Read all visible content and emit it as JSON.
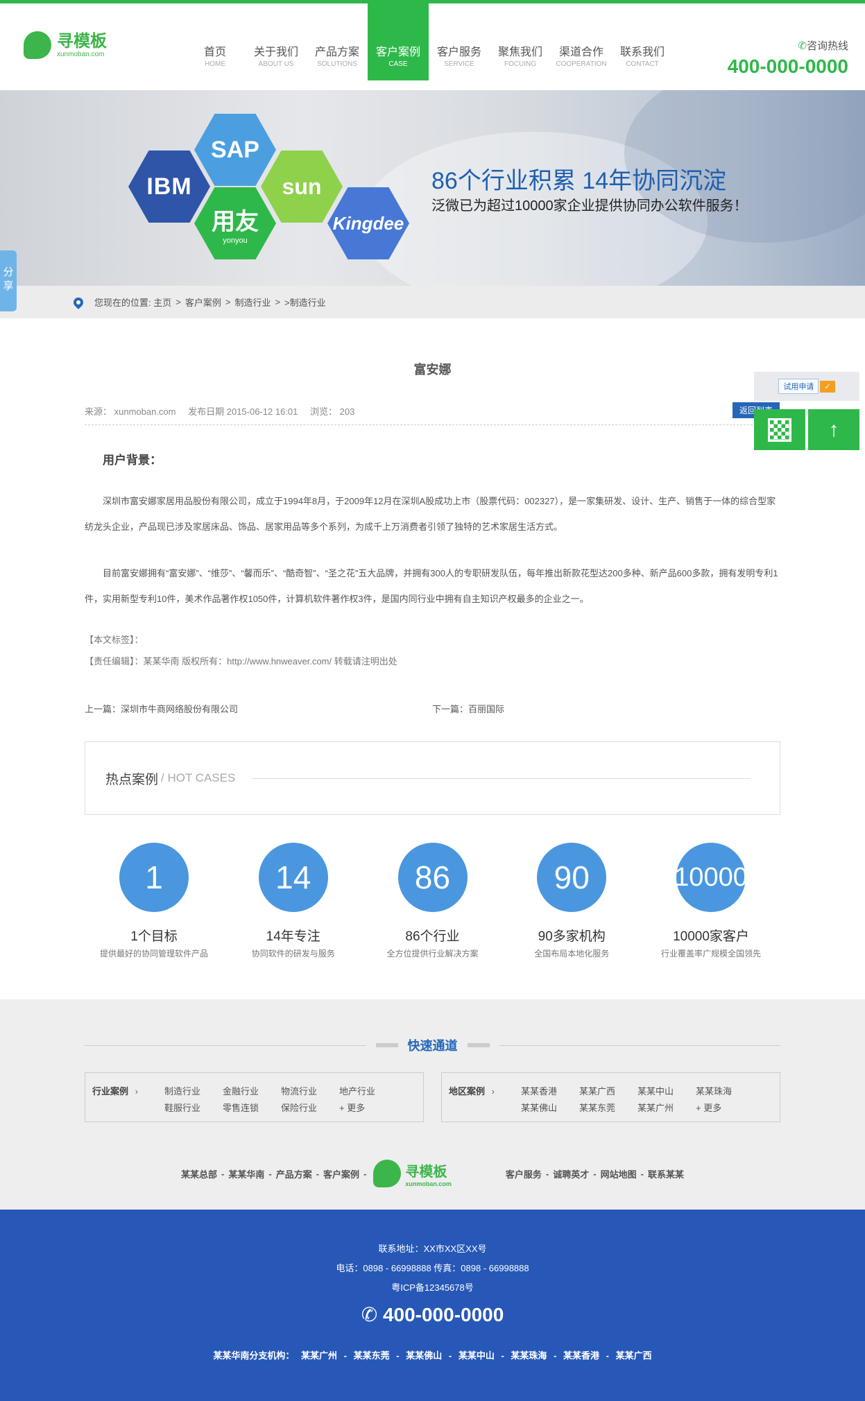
{
  "header": {
    "logo_cn": "寻模板",
    "logo_en": "xunmoban.com",
    "nav": [
      {
        "cn": "首页",
        "en": "HOME"
      },
      {
        "cn": "关于我们",
        "en": "ABOUT US"
      },
      {
        "cn": "产品方案",
        "en": "SOLUTIONS"
      },
      {
        "cn": "客户案例",
        "en": "CASE"
      },
      {
        "cn": "客户服务",
        "en": "SERVICE"
      },
      {
        "cn": "聚焦我们",
        "en": "FOCUING"
      },
      {
        "cn": "渠道合作",
        "en": "COOPERATION"
      },
      {
        "cn": "联系我们",
        "en": "CONTACT"
      }
    ],
    "hotline_label": "咨询热线",
    "hotline": "400-000-0000"
  },
  "banner": {
    "logos": {
      "ibm": "IBM",
      "sap": "SAP",
      "sun": "sun",
      "yonyou": "用友",
      "yonyou_en": "yonyou",
      "kingdee": "Kingdee"
    },
    "headline": "86个行业积累  14年协同沉淀",
    "subline": "泛微已为超过10000家企业提供协同办公软件服务！"
  },
  "share": "分享",
  "breadcrumb": [
    "您现在的位置: 主页",
    ">",
    "客户案例",
    ">",
    "制造行业",
    ">",
    ">制造行业"
  ],
  "article": {
    "title": "富安娜",
    "source": "来源： xunmoban.com",
    "date": "发布日期 2015-06-12 16:01",
    "views": "浏览： 203",
    "section": "用户背景：",
    "p1": "深圳市富安娜家居用品股份有限公司，成立于1994年8月，于2009年12月在深圳A股成功上市（股票代码：002327），是一家集研发、设计、生产、销售于一体的综合型家纺龙头企业，产品现已涉及家居床品、饰品、居家用品等多个系列，为成千上万消费者引领了独特的艺术家居生活方式。",
    "p2": "目前富安娜拥有“富安娜”、“维莎”、“馨而乐”、“酷奇智”、“圣之花”五大品牌，并拥有300人的专职研发队伍，每年推出新款花型达200多种、新产品600多款，拥有发明专利1件，实用新型专利10件，美术作品著作权1050件，计算机软件著作权3件，是国内同行业中拥有自主知识产权最多的企业之一。",
    "tags": "【本文标签】：",
    "editor": "【责任编辑】：某某华南   版权所有：http://www.hnweaver.com/ 转载请注明出处",
    "prev": "上一篇：深圳市牛商网络股份有限公司",
    "next": "下一篇：百丽国际"
  },
  "hot": {
    "title": "热点案例",
    "sub": "/ HOT CASES"
  },
  "stats": [
    {
      "num": "1",
      "title": "1个目标",
      "desc": "提供最好的协同管理软件产品"
    },
    {
      "num": "14",
      "title": "14年专注",
      "desc": "协同软件的研发与服务"
    },
    {
      "num": "86",
      "title": "86个行业",
      "desc": "全方位提供行业解决方案"
    },
    {
      "num": "90",
      "title": "90多家机构",
      "desc": "全国布局本地化服务"
    },
    {
      "num": "10000",
      "title": "10000家客户",
      "desc": "行业覆盖率广规模全国领先"
    }
  ],
  "quick": {
    "title": "快速通道",
    "industry_label": "行业案例",
    "industry": [
      "制造行业",
      "金融行业",
      "物流行业",
      "地产行业",
      "鞋服行业",
      "零售连锁",
      "保险行业",
      "+ 更多"
    ],
    "region_label": "地区案例",
    "region": [
      "某某香港",
      "某某广西",
      "某某中山",
      "某某珠海",
      "某某佛山",
      "某某东莞",
      "某某广州",
      "+ 更多"
    ]
  },
  "footer_links": {
    "left": [
      "某某总部",
      "-",
      "某某华南",
      "-",
      "产品方案",
      "-",
      "客户案例",
      "-"
    ],
    "right": [
      "客户服务",
      "-",
      "诚聘英才",
      "-",
      "网站地图",
      "-",
      "联系某某"
    ]
  },
  "bottom": {
    "address": "联系地址：XX市XX区XX号",
    "phone": "电话：0898 - 66998888 传真：0898 - 66998888",
    "icp": "粤ICP备12345678号",
    "hotline": "400-000-0000",
    "branches_label": "某某华南分支机构：",
    "branches": [
      "某某广州",
      "-",
      "某某东莞",
      "-",
      "某某佛山",
      "-",
      "某某中山",
      "-",
      "某某珠海",
      "-",
      "某某香港",
      "-",
      "某某广西"
    ]
  },
  "float": {
    "trial": "试用申请",
    "back": "返回列表"
  },
  "colors": {
    "green": "#2fb84a",
    "blue": "#2466b8",
    "circle": "#4a97e0",
    "footer": "#2758b7"
  }
}
